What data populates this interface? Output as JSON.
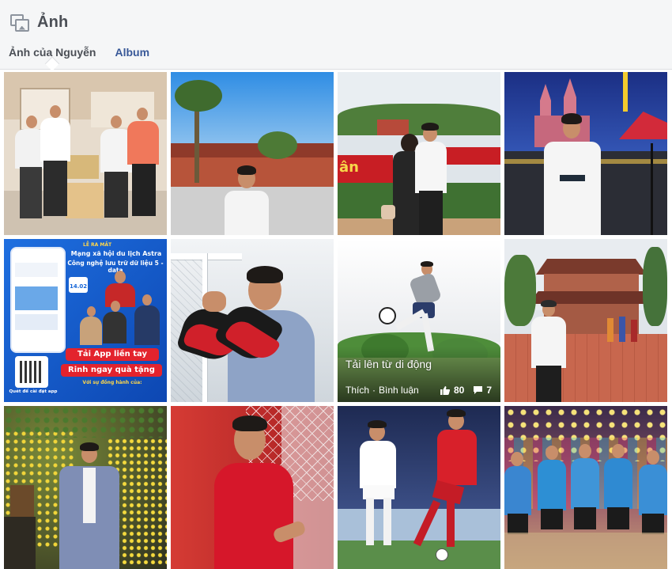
{
  "header": {
    "title": "Ảnh",
    "tabs": [
      {
        "label": "Ảnh của Nguyễn",
        "active": true
      },
      {
        "label": "Album",
        "active": false
      }
    ]
  },
  "photos": [
    {
      "id": "p1",
      "subject": "group-donation"
    },
    {
      "id": "p2",
      "subject": "temple-blue-sky"
    },
    {
      "id": "p3",
      "subject": "couple-festival"
    },
    {
      "id": "p4",
      "subject": "cathedral-night"
    },
    {
      "id": "p5",
      "subject": "astra-app-ad",
      "texts": {
        "launch": "LỄ RA MẮT",
        "headline1": "Mạng xã hội du lịch Astra",
        "headline2": "Công nghệ lưu trữ dữ liệu 5 - data",
        "date": "14.02",
        "cta1": "Tải App liền tay",
        "cta2": "Rinh ngay quà tặng",
        "companion": "Với sự đồng hành của:",
        "qr_label": "Quét để cài đặt app"
      }
    },
    {
      "id": "p6",
      "subject": "football-boots"
    },
    {
      "id": "p7",
      "subject": "bicycle-kick",
      "hovered": true,
      "overlay": {
        "caption": "Tải lên từ di động",
        "like": "Thích",
        "comment": "Bình luận",
        "likes": "80",
        "comments": "7"
      }
    },
    {
      "id": "p8",
      "subject": "pagoda-visit"
    },
    {
      "id": "p9",
      "subject": "apricot-blossom"
    },
    {
      "id": "p10",
      "subject": "red-jersey-22"
    },
    {
      "id": "p11",
      "subject": "match-action"
    },
    {
      "id": "p12",
      "subject": "team-blue-shirts"
    }
  ],
  "colors": {
    "header_bg": "#f5f6f7",
    "link": "#385898",
    "title": "#4b4f56",
    "border": "#dddfe2"
  }
}
